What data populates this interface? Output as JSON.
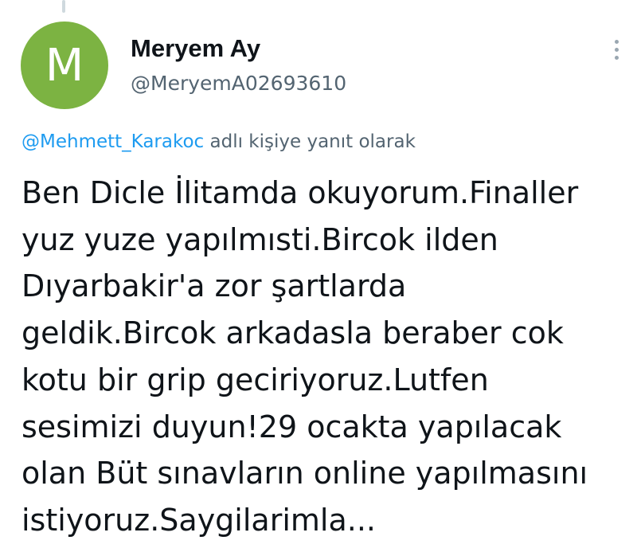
{
  "author": {
    "avatar_initial": "M",
    "avatar_color": "#7cb342",
    "display_name": "Meryem Ay",
    "handle": "@MeryemA02693610"
  },
  "more_icon": "more-vertical-icon",
  "reply_context": {
    "mention": "@Mehmett_Karakoc",
    "suffix": " adlı kişiye yanıt olarak"
  },
  "tweet": {
    "lines": [
      "Ben Dicle İlitamda okuyorum.Finaller",
      "yuz yuze yapılmısti.Bircok ilden",
      "Dıyarbakir'a zor şartlarda",
      "geldik.Bircok arkadasla beraber cok",
      "kotu bir grip geciriyoruz.Lutfen",
      "sesimizi duyun!29 ocakta yapılacak",
      "olan Büt sınavların online yapılmasını",
      "istiyoruz.Saygilarimla..."
    ]
  },
  "colors": {
    "link": "#1d9bf0",
    "secondary_text": "#536471",
    "primary_text": "#0f1419"
  }
}
